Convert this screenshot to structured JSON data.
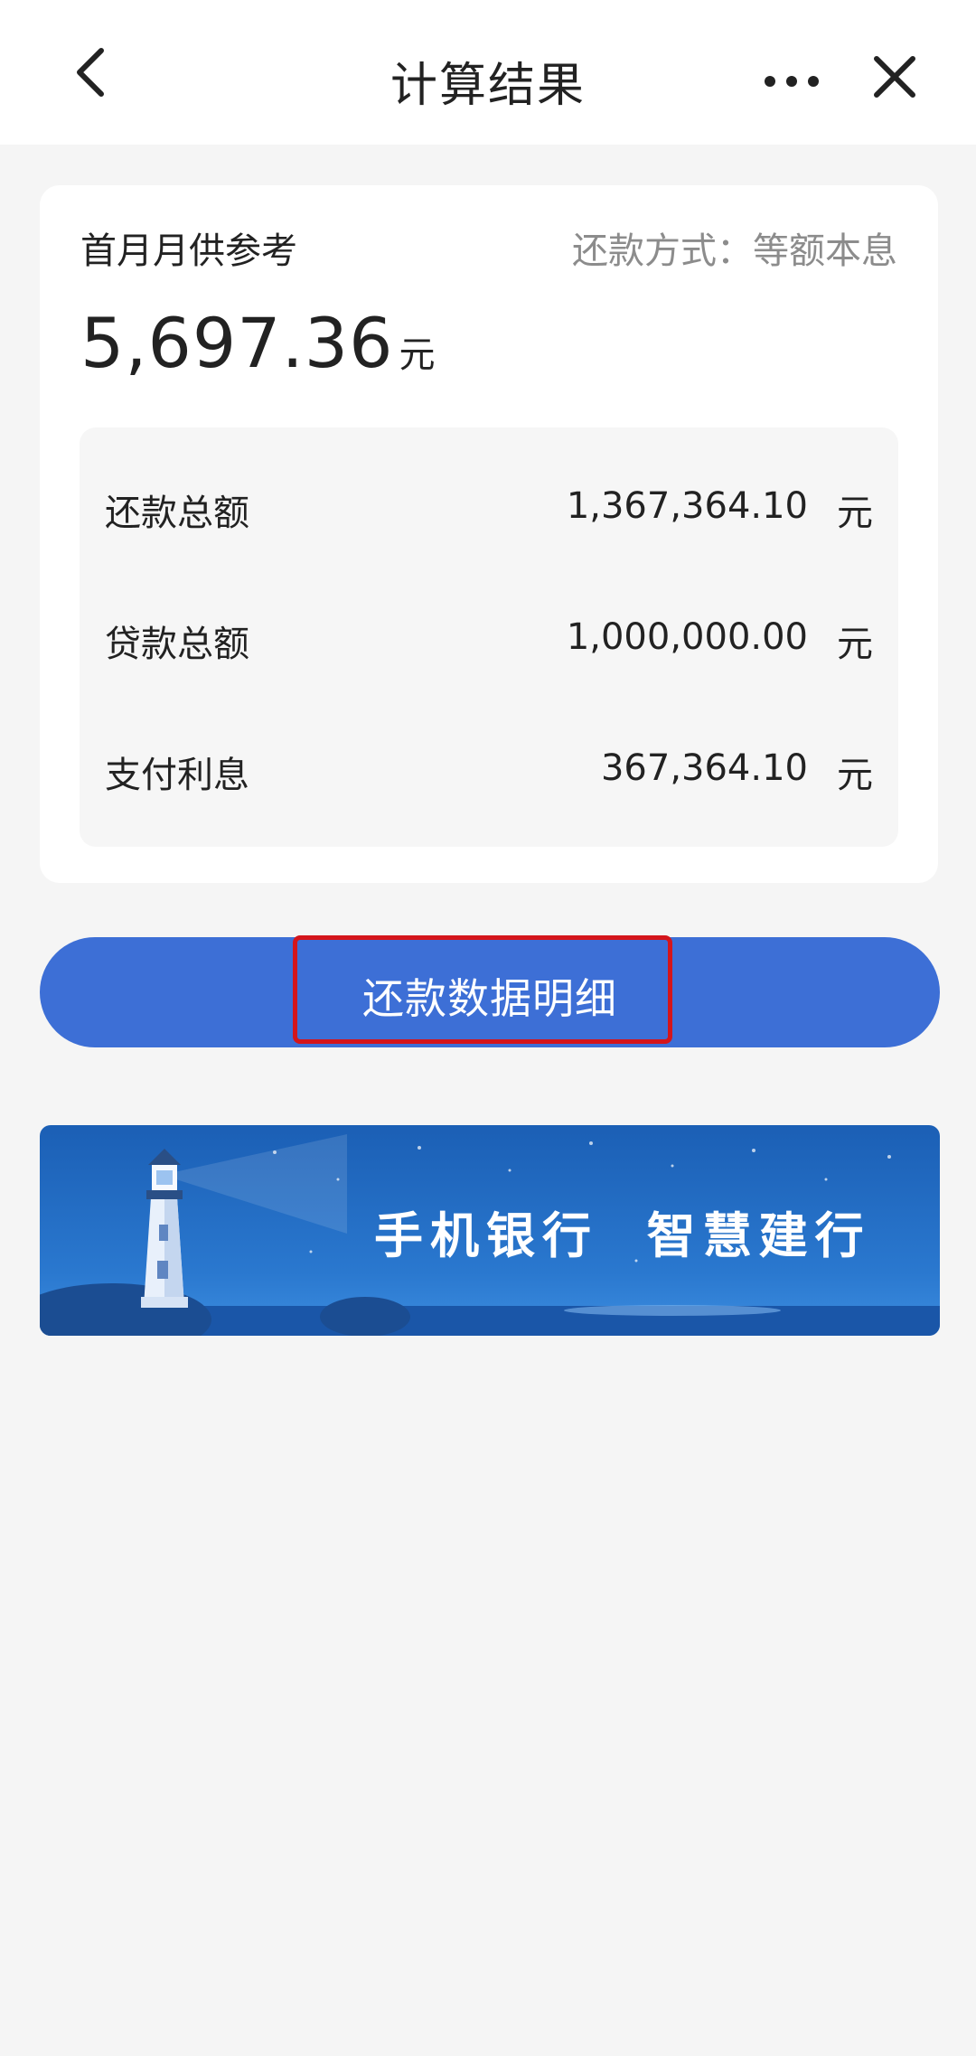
{
  "header": {
    "title": "计算结果",
    "back_icon": "chevron-left-icon",
    "more_icon": "more-dots-icon",
    "close_icon": "close-icon"
  },
  "result": {
    "first_month_label": "首月月供参考",
    "repay_method": "还款方式：等额本息",
    "monthly_amount": "5,697.36",
    "monthly_unit": "元",
    "summary": [
      {
        "label": "还款总额",
        "value": "1,367,364.10",
        "unit": "元"
      },
      {
        "label": "贷款总额",
        "value": "1,000,000.00",
        "unit": "元"
      },
      {
        "label": "支付利息",
        "value": "367,364.10",
        "unit": "元"
      }
    ]
  },
  "detail_button": {
    "label": "还款数据明细"
  },
  "banner": {
    "text": "手机银行  智慧建行",
    "art_icon": "lighthouse-icon"
  },
  "colors": {
    "primary": "#3d6fd6",
    "highlight": "#d4151b",
    "background": "#f5f5f5"
  }
}
